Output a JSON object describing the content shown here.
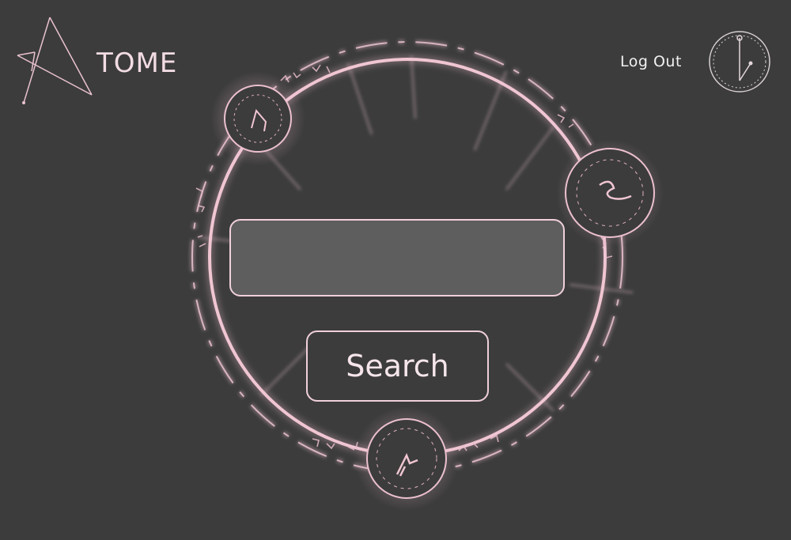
{
  "app": {
    "brand": "TOME",
    "logout_label": "Log Out"
  },
  "search": {
    "value": "",
    "placeholder": "",
    "button_label": "Search"
  },
  "icons": {
    "logo": "triangle-logo-icon",
    "account": "clock-sigil-icon",
    "decoration": "magic-circle"
  },
  "colors": {
    "background": "#3c3c3c",
    "accent": "#f0c8d4",
    "input_fill": "#5e5e5e",
    "text": "#f3f3f3"
  }
}
